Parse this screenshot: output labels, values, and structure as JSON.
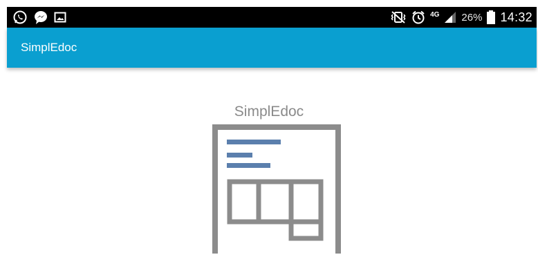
{
  "status_bar": {
    "left_icons": [
      "whatsapp-icon",
      "messenger-icon",
      "image-icon"
    ],
    "right_icons": [
      "vibrate-icon",
      "alarm-icon",
      "network-4g-icon",
      "signal-icon",
      "battery-icon"
    ],
    "network_label": "4G",
    "battery_percent": "26%",
    "time": "14:32"
  },
  "app_bar": {
    "title": "SimplEdoc",
    "color": "#0a9fd0"
  },
  "main": {
    "title": "SimplEdoc",
    "logo_icon": "document-layout-icon"
  }
}
